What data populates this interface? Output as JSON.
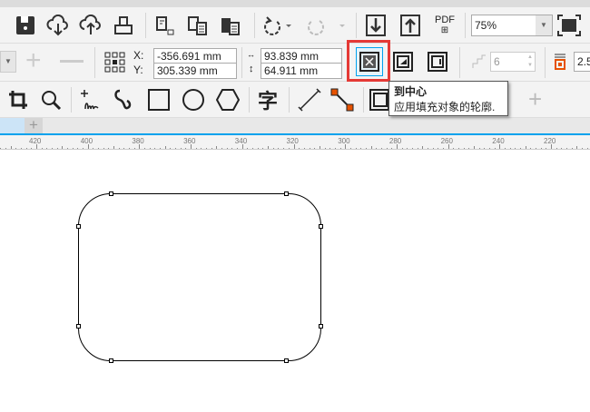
{
  "standard_toolbar": {
    "zoom_level": "75%",
    "pdf_label": "PDF"
  },
  "property_bar": {
    "x_label": "X:",
    "y_label": "Y:",
    "x_value": "-356.691 mm",
    "y_value": "305.339 mm",
    "width_value": "93.839 mm",
    "height_value": "64.911 mm",
    "steps_value": "6",
    "outline_value": "2.5"
  },
  "toolbox": {
    "text_tool_glyph": "字"
  },
  "tooltip": {
    "title": "到中心",
    "description": "应用填充对象的轮廓."
  },
  "tabs": {
    "add_glyph": "+"
  },
  "ruler": {
    "ticks": [
      "420",
      "400",
      "380",
      "360",
      "340",
      "320",
      "300",
      "280",
      "260",
      "240",
      "220"
    ]
  },
  "colors": {
    "highlight": "#e53935",
    "accent": "#00a2ed"
  }
}
